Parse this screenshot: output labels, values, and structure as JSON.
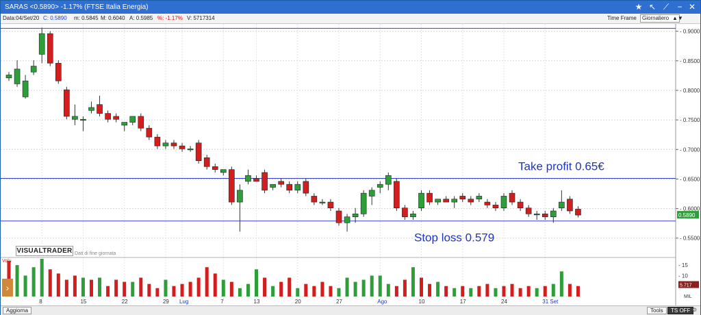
{
  "window": {
    "title": "SARAS <0.5890> -1.17% (FTSE Italia Energia)"
  },
  "infobar": {
    "date": "Data:04/Set/20",
    "close": "C: 0.5890",
    "min": "m: 0.5845",
    "max": "M: 0.6040",
    "open": "A: 0.5985",
    "pct": "%: -1.17%",
    "volume": "V: 5717314",
    "time_frame_label": "Time Frame",
    "time_frame_value": "Giornaliero"
  },
  "chart_data": {
    "type": "candlestick",
    "ylim": [
      0.53,
      0.91
    ],
    "y_ticks": [
      "0.9000",
      "0.8500",
      "0.8000",
      "0.7500",
      "0.7000",
      "0.6500",
      "0.6000",
      "0.5500"
    ],
    "x_labels": [
      "8",
      "15",
      "22",
      "29",
      "Lug",
      "7",
      "13",
      "20",
      "27",
      "Ago",
      "10",
      "17",
      "24",
      "31 Set"
    ],
    "last_price_label": "0.5890",
    "horizontal_lines": [
      0.905,
      0.651,
      0.579
    ],
    "annotations": [
      {
        "text": "Take profit 0.65€",
        "y": 0.651
      },
      {
        "text": "Stop loss 0.579",
        "y": 0.579
      }
    ],
    "candles": [
      [
        0.821,
        0.831,
        0.816,
        0.826
      ],
      [
        0.811,
        0.851,
        0.806,
        0.836
      ],
      [
        0.789,
        0.826,
        0.786,
        0.816
      ],
      [
        0.831,
        0.851,
        0.826,
        0.841
      ],
      [
        0.861,
        0.906,
        0.846,
        0.896
      ],
      [
        0.896,
        0.9,
        0.841,
        0.846
      ],
      [
        0.846,
        0.851,
        0.811,
        0.816
      ],
      [
        0.801,
        0.806,
        0.751,
        0.756
      ],
      [
        0.751,
        0.776,
        0.741,
        0.756
      ],
      [
        0.751,
        0.756,
        0.731,
        0.751
      ],
      [
        0.766,
        0.781,
        0.761,
        0.771
      ],
      [
        0.776,
        0.791,
        0.756,
        0.761
      ],
      [
        0.761,
        0.766,
        0.746,
        0.751
      ],
      [
        0.756,
        0.761,
        0.746,
        0.751
      ],
      [
        0.741,
        0.746,
        0.731,
        0.746
      ],
      [
        0.746,
        0.756,
        0.741,
        0.756
      ],
      [
        0.756,
        0.761,
        0.731,
        0.736
      ],
      [
        0.736,
        0.741,
        0.716,
        0.721
      ],
      [
        0.721,
        0.726,
        0.701,
        0.706
      ],
      [
        0.706,
        0.716,
        0.701,
        0.711
      ],
      [
        0.711,
        0.716,
        0.701,
        0.706
      ],
      [
        0.706,
        0.711,
        0.696,
        0.701
      ],
      [
        0.701,
        0.706,
        0.696,
        0.701
      ],
      [
        0.711,
        0.716,
        0.676,
        0.681
      ],
      [
        0.686,
        0.691,
        0.666,
        0.671
      ],
      [
        0.671,
        0.676,
        0.661,
        0.666
      ],
      [
        0.661,
        0.666,
        0.656,
        0.666
      ],
      [
        0.666,
        0.671,
        0.606,
        0.611
      ],
      [
        0.611,
        0.641,
        0.561,
        0.631
      ],
      [
        0.646,
        0.666,
        0.641,
        0.656
      ],
      [
        0.651,
        0.656,
        0.646,
        0.646
      ],
      [
        0.661,
        0.666,
        0.626,
        0.631
      ],
      [
        0.636,
        0.641,
        0.631,
        0.641
      ],
      [
        0.646,
        0.651,
        0.636,
        0.641
      ],
      [
        0.641,
        0.646,
        0.626,
        0.631
      ],
      [
        0.631,
        0.646,
        0.626,
        0.641
      ],
      [
        0.646,
        0.651,
        0.621,
        0.626
      ],
      [
        0.621,
        0.626,
        0.606,
        0.611
      ],
      [
        0.611,
        0.616,
        0.606,
        0.611
      ],
      [
        0.611,
        0.616,
        0.596,
        0.601
      ],
      [
        0.596,
        0.601,
        0.571,
        0.576
      ],
      [
        0.576,
        0.591,
        0.561,
        0.586
      ],
      [
        0.586,
        0.601,
        0.576,
        0.591
      ],
      [
        0.591,
        0.631,
        0.586,
        0.626
      ],
      [
        0.621,
        0.636,
        0.606,
        0.631
      ],
      [
        0.636,
        0.646,
        0.626,
        0.641
      ],
      [
        0.641,
        0.661,
        0.631,
        0.656
      ],
      [
        0.646,
        0.651,
        0.596,
        0.601
      ],
      [
        0.601,
        0.606,
        0.581,
        0.586
      ],
      [
        0.586,
        0.596,
        0.581,
        0.591
      ],
      [
        0.601,
        0.631,
        0.596,
        0.626
      ],
      [
        0.626,
        0.631,
        0.606,
        0.611
      ],
      [
        0.611,
        0.616,
        0.606,
        0.616
      ],
      [
        0.616,
        0.621,
        0.611,
        0.611
      ],
      [
        0.611,
        0.621,
        0.601,
        0.616
      ],
      [
        0.621,
        0.626,
        0.611,
        0.616
      ],
      [
        0.616,
        0.621,
        0.606,
        0.611
      ],
      [
        0.616,
        0.626,
        0.611,
        0.621
      ],
      [
        0.611,
        0.616,
        0.601,
        0.606
      ],
      [
        0.606,
        0.611,
        0.596,
        0.601
      ],
      [
        0.601,
        0.626,
        0.596,
        0.621
      ],
      [
        0.626,
        0.631,
        0.606,
        0.611
      ],
      [
        0.611,
        0.616,
        0.596,
        0.601
      ],
      [
        0.601,
        0.606,
        0.586,
        0.591
      ],
      [
        0.591,
        0.596,
        0.581,
        0.591
      ],
      [
        0.591,
        0.596,
        0.581,
        0.586
      ],
      [
        0.586,
        0.601,
        0.576,
        0.596
      ],
      [
        0.601,
        0.631,
        0.596,
        0.611
      ],
      [
        0.616,
        0.621,
        0.591,
        0.596
      ],
      [
        0.599,
        0.604,
        0.585,
        0.589
      ]
    ],
    "volume": {
      "label": "Volu",
      "ylim": [
        0,
        18
      ],
      "y_ticks": [
        "15",
        "10",
        "5"
      ],
      "value_label": "5.717",
      "unit": "MIL",
      "values": [
        17,
        15,
        10,
        14,
        18,
        13,
        11,
        8,
        10,
        9,
        8,
        9,
        5,
        8,
        7,
        7,
        9,
        6,
        4,
        8,
        5,
        6,
        7,
        9,
        14,
        11,
        8,
        7,
        4,
        6,
        13,
        9,
        5,
        7,
        9,
        4,
        6,
        5,
        7,
        5,
        4,
        9,
        7,
        8,
        10,
        10,
        6,
        5,
        8,
        14,
        9,
        6,
        7,
        5,
        4,
        5,
        4,
        5,
        6,
        4,
        5,
        6,
        4,
        5,
        4,
        5,
        6,
        12,
        6,
        5
      ],
      "up": [
        false,
        true,
        true,
        true,
        true,
        false,
        false,
        false,
        false,
        true,
        false,
        true,
        false,
        false,
        false,
        true,
        false,
        false,
        false,
        true,
        false,
        false,
        false,
        false,
        false,
        false,
        true,
        false,
        true,
        true,
        true,
        false,
        true,
        false,
        false,
        true,
        false,
        false,
        false,
        false,
        true,
        true,
        true,
        true,
        true,
        true,
        true,
        false,
        false,
        true,
        false,
        false,
        true,
        false,
        true,
        false,
        true,
        false,
        false,
        true,
        false,
        false,
        false,
        false,
        true,
        false,
        true,
        true,
        false,
        false
      ]
    }
  },
  "panel": {
    "logo": "VISUALTRADER",
    "subtitle": "Dati di fine giornata"
  },
  "bottombar": {
    "update": "Aggiorna",
    "tools": "Tools",
    "ts": "TS OFF"
  }
}
